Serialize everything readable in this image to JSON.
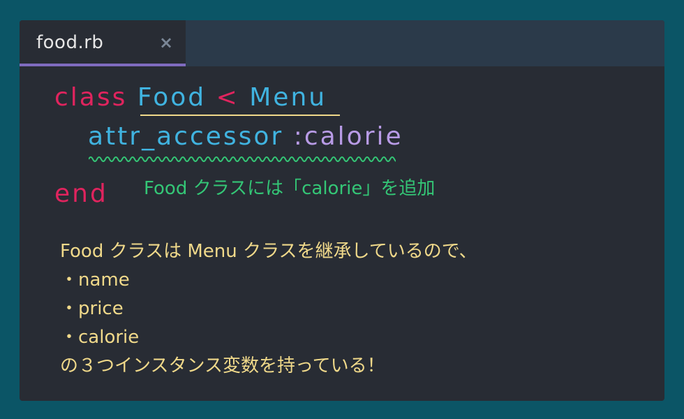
{
  "tab": {
    "filename": "food.rb",
    "close_glyph": "×"
  },
  "code": {
    "line1": {
      "keyword": "class",
      "class_name": "Food",
      "operator": "<",
      "parent": "Menu"
    },
    "line2": {
      "method": "attr_accessor",
      "symbol": ":calorie"
    },
    "line3": {
      "keyword": "end"
    }
  },
  "annotation": "Food クラスには「calorie」を追加",
  "description": {
    "intro": "Food クラスは Menu クラスを継承しているので、",
    "items": [
      "・name",
      "・price",
      "・calorie"
    ],
    "outro": "の３つインスタンス変数を持っている！"
  },
  "colors": {
    "background": "#0b5566",
    "editor": "#282c34",
    "tabbar": "#2b3a4a",
    "tab_accent": "#7f6bbf",
    "keyword": "#e0245e",
    "class_name": "#40b3e0",
    "symbol": "#b89be6",
    "note_green": "#34c676",
    "note_yellow": "#f0d98a"
  },
  "icons": {
    "tab_close": "close-icon",
    "wavy_underline": "wavy-underline"
  }
}
